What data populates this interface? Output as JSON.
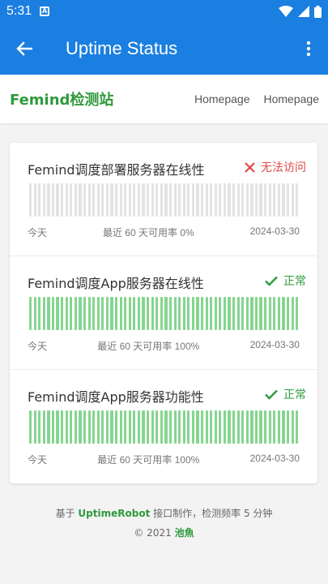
{
  "statusbar": {
    "time": "5:31",
    "sim_label": "A"
  },
  "appbar": {
    "title": "Uptime Status"
  },
  "site": {
    "brand": "Femind检测站",
    "links": [
      "Homepage",
      "Homepage"
    ]
  },
  "monitors": [
    {
      "name": "Femind调度部署服务器在线性",
      "status": "无法访问",
      "state": "down",
      "left_label": "今天",
      "uptime_label": "最近 60 天可用率 0%",
      "date": "2024-03-30",
      "color": "#e04848"
    },
    {
      "name": "Femind调度App服务器在线性",
      "status": "正常",
      "state": "up",
      "left_label": "今天",
      "uptime_label": "最近 60 天可用率 100%",
      "date": "2024-03-30",
      "color": "#2e9a3c"
    },
    {
      "name": "Femind调度App服务器功能性",
      "status": "正常",
      "state": "up",
      "left_label": "今天",
      "uptime_label": "最近 60 天可用率 100%",
      "date": "2024-03-30",
      "color": "#2e9a3c"
    }
  ],
  "footer": {
    "line1_prefix": "基于 ",
    "line1_highlight": "UptimeRobot",
    "line1_suffix": " 接口制作，检测频率 5 分钟",
    "line2_prefix": "© 2021 ",
    "line2_highlight": "池魚"
  },
  "colors": {
    "primary": "#1a7fe0",
    "brand": "#2e9a3c",
    "down": "#e04848",
    "bar_up": "#86d58f",
    "bar_none": "#e3e3e3"
  }
}
